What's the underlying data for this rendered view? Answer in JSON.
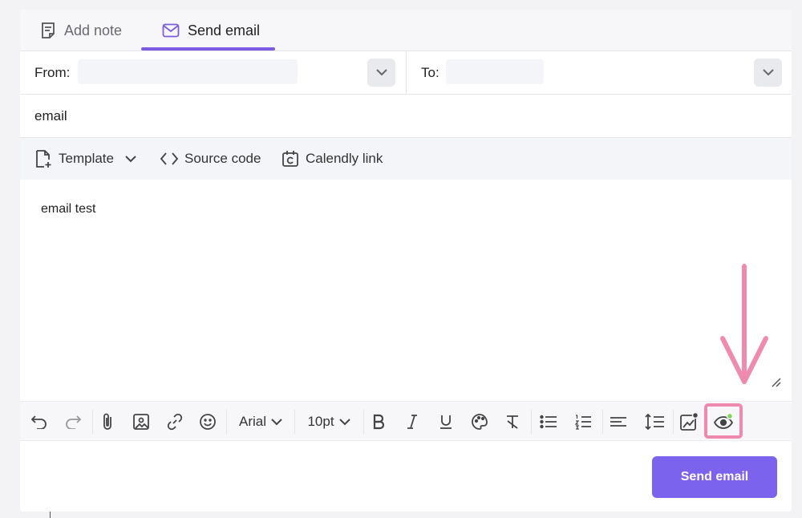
{
  "tabs": [
    {
      "label": "Add note",
      "icon": "note-icon",
      "active": false
    },
    {
      "label": "Send email",
      "icon": "mail-icon",
      "active": true
    }
  ],
  "from": {
    "label": "From:",
    "value": ""
  },
  "to": {
    "label": "To:",
    "value": ""
  },
  "subject": {
    "value": "email"
  },
  "top_toolbar": {
    "template": "Template",
    "source_code": "Source code",
    "calendly": "Calendly link"
  },
  "editor": {
    "body": "email test"
  },
  "format_toolbar": {
    "font": "Arial",
    "size": "10pt"
  },
  "actions": {
    "send_label": "Send email"
  },
  "colors": {
    "accent": "#7b5ce0",
    "send_button": "#7b63ee",
    "highlight": "#f08aac",
    "status_dot": "#7ed957"
  }
}
